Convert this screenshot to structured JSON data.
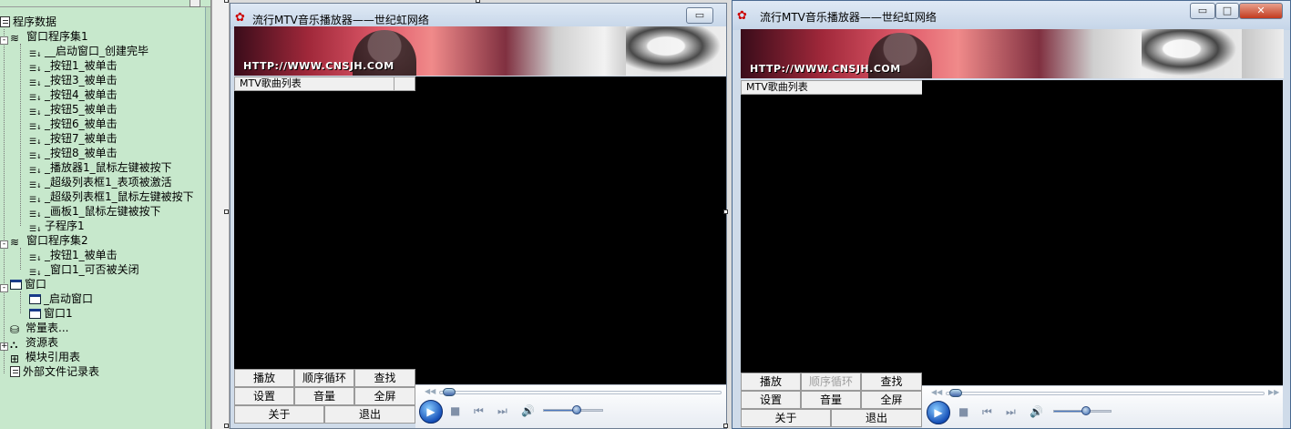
{
  "tree": {
    "root_label": "程序数据",
    "items": [
      {
        "label": "窗口程序集1",
        "icon": "stack-icon",
        "level": 1,
        "expand": "-"
      },
      {
        "label": "__启动窗口_创建完毕",
        "icon": "subroutine-icon",
        "level": 2
      },
      {
        "label": "_按钮1_被单击",
        "icon": "subroutine-icon",
        "level": 2
      },
      {
        "label": "_按钮3_被单击",
        "icon": "subroutine-icon",
        "level": 2
      },
      {
        "label": "_按钮4_被单击",
        "icon": "subroutine-icon",
        "level": 2
      },
      {
        "label": "_按钮5_被单击",
        "icon": "subroutine-icon",
        "level": 2
      },
      {
        "label": "_按钮6_被单击",
        "icon": "subroutine-icon",
        "level": 2
      },
      {
        "label": "_按钮7_被单击",
        "icon": "subroutine-icon",
        "level": 2
      },
      {
        "label": "_按钮8_被单击",
        "icon": "subroutine-icon",
        "level": 2
      },
      {
        "label": "_播放器1_鼠标左键被按下",
        "icon": "subroutine-icon",
        "level": 2
      },
      {
        "label": "_超级列表框1_表项被激活",
        "icon": "subroutine-icon",
        "level": 2
      },
      {
        "label": "_超级列表框1_鼠标左键被按下",
        "icon": "subroutine-icon",
        "level": 2
      },
      {
        "label": "_画板1_鼠标左键被按下",
        "icon": "subroutine-icon",
        "level": 2
      },
      {
        "label": "子程序1",
        "icon": "subroutine-icon",
        "level": 2
      },
      {
        "label": "窗口程序集2",
        "icon": "stack-icon",
        "level": 1,
        "expand": "-"
      },
      {
        "label": "_按钮1_被单击",
        "icon": "subroutine-icon",
        "level": 2
      },
      {
        "label": "_窗口1_可否被关闭",
        "icon": "subroutine-icon",
        "level": 2
      },
      {
        "label": "窗口",
        "icon": "window-icon",
        "level": 1,
        "expand": "-"
      },
      {
        "label": "_启动窗口",
        "icon": "window-icon",
        "level": 2
      },
      {
        "label": "窗口1",
        "icon": "window-icon",
        "level": 2
      },
      {
        "label": "常量表...",
        "icon": "constant-icon",
        "level": 1
      },
      {
        "label": "资源表",
        "icon": "resource-icon",
        "level": 1,
        "expand": "+"
      },
      {
        "label": "模块引用表",
        "icon": "module-icon",
        "level": 1
      },
      {
        "label": "外部文件记录表",
        "icon": "file-icon",
        "level": 1
      }
    ]
  },
  "player": {
    "title": "流行MTV音乐播放器——世纪虹网络",
    "banner_url": "HTTP://WWW.CNSJH.COM",
    "list_header": "MTV歌曲列表",
    "buttons": {
      "play": "播放",
      "loop": "顺序循环",
      "find": "查找",
      "settings": "设置",
      "volume": "音量",
      "fullscreen": "全屏",
      "about": "关于",
      "exit": "退出"
    },
    "minimize_glyph": "▭",
    "maximize_glyph": "□",
    "close_glyph": "✕",
    "volume_level": 0.55
  },
  "colors": {
    "tree_bg": "#c7e8cc",
    "titlebar": "#c5d5e8",
    "video_bg": "#000000",
    "wmp_play": "#1650b8"
  }
}
